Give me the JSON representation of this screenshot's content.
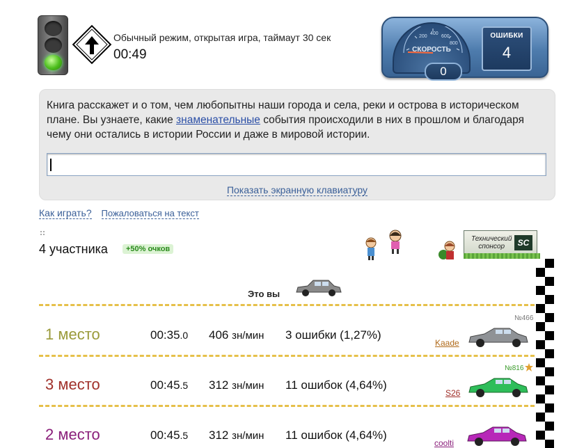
{
  "header": {
    "mode_text": "Обычный режим, открытая игра, таймаут 30 сек",
    "timer": "00:49"
  },
  "dashboard": {
    "speed_label": "СКОРОСТЬ",
    "speed_value": "0",
    "gauge_ticks": [
      "200",
      "400",
      "600",
      "800"
    ],
    "errors_label": "ОШИБКИ",
    "errors_value": "4"
  },
  "passage": {
    "before": "Книга расскажет и о том, чем любопытны наши города и села, реки и острова в историческом плане. Вы узнаете, какие ",
    "link": "знаменательные",
    "after": " события происходили в них в прошлом и благодаря чему они остались в истории России и даже в мировой истории."
  },
  "input": {
    "value": ""
  },
  "keyboard_link": "Показать экранную клавиатуру",
  "links": {
    "how_to_play": "Как играть?",
    "complain": "Пожаловаться на текст"
  },
  "participants": {
    "count_text": "4 участника",
    "bonus": "+50% очков"
  },
  "sponsor": {
    "line1": "Технический",
    "line2": "спонсор",
    "logo": "SC"
  },
  "you_label": "Это вы",
  "colors": {
    "accent_blue": "#3a5f98",
    "dash": "#e6c04a",
    "place1": "#9a9a3a",
    "place3": "#a0302a",
    "place2": "#8a1f7a"
  },
  "results": [
    {
      "place": "1 место",
      "time_main": "00:35",
      "time_ms": ".0",
      "speed": "406",
      "speed_unit": "зн/мин",
      "errors": "3 ошибки (1,27%)",
      "name": "Kaade",
      "number": "№466",
      "car_color": "#8f9296",
      "place_color": "#9a9a3a",
      "name_color": "#b06a1a",
      "number_color": "#777"
    },
    {
      "place": "3 место",
      "time_main": "00:45",
      "time_ms": ".5",
      "speed": "312",
      "speed_unit": "зн/мин",
      "errors": "11 ошибок (4,64%)",
      "name": "S26",
      "number": "№816",
      "car_color": "#2ebd5a",
      "place_color": "#a0302a",
      "name_color": "#a0302a",
      "number_color": "#3a9a2a"
    },
    {
      "place": "2 место",
      "time_main": "00:45",
      "time_ms": ".5",
      "speed": "312",
      "speed_unit": "зн/мин",
      "errors": "11 ошибок (4,64%)",
      "name": "coolti",
      "number": "",
      "car_color": "#b728b8",
      "place_color": "#8a1f7a",
      "name_color": "#8a1f7a",
      "number_color": "#777"
    }
  ]
}
